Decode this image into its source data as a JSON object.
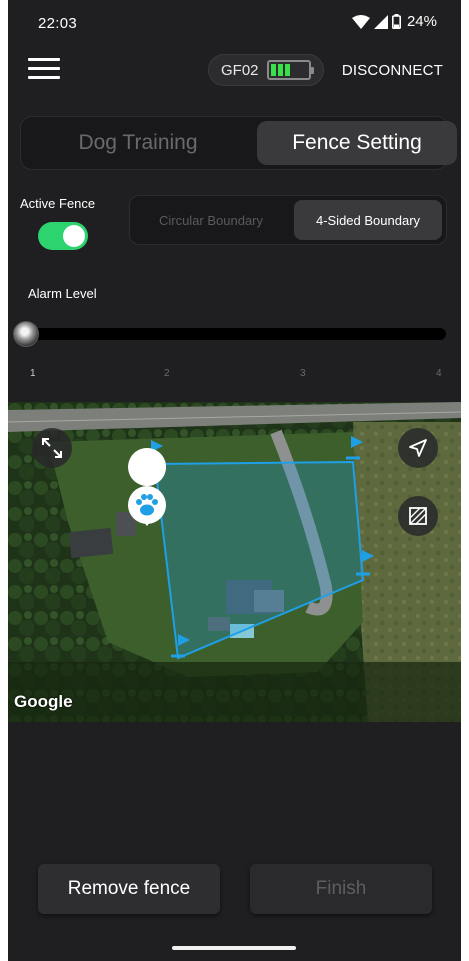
{
  "status": {
    "time": "22:03",
    "battery_pct": "24%"
  },
  "header": {
    "device_name": "GF02",
    "disconnect_label": "DISCONNECT"
  },
  "mode_tabs": [
    {
      "label": "Dog Training",
      "selected": false
    },
    {
      "label": "Fence Setting",
      "selected": true
    }
  ],
  "fence": {
    "active_label": "Active Fence",
    "active": true,
    "boundary_options": [
      {
        "label": "Circular Boundary",
        "selected": false
      },
      {
        "label": "4-Sided Boundary",
        "selected": true
      }
    ]
  },
  "alarm": {
    "label": "Alarm Level",
    "value": 1,
    "ticks": [
      "1",
      "2",
      "3",
      "4"
    ]
  },
  "map": {
    "attribution": "Google"
  },
  "actions": {
    "remove_label": "Remove fence",
    "finish_label": "Finish"
  },
  "colors": {
    "accent_green": "#2dd36f",
    "fence_blue": "#1f9fe6",
    "battery_green": "#39e04a"
  },
  "icons": {
    "menu": "menu-icon",
    "expand": "expand-icon",
    "locate": "navigation-arrow-icon",
    "map_type": "map-layer-icon",
    "pet": "paw-marker-icon"
  }
}
